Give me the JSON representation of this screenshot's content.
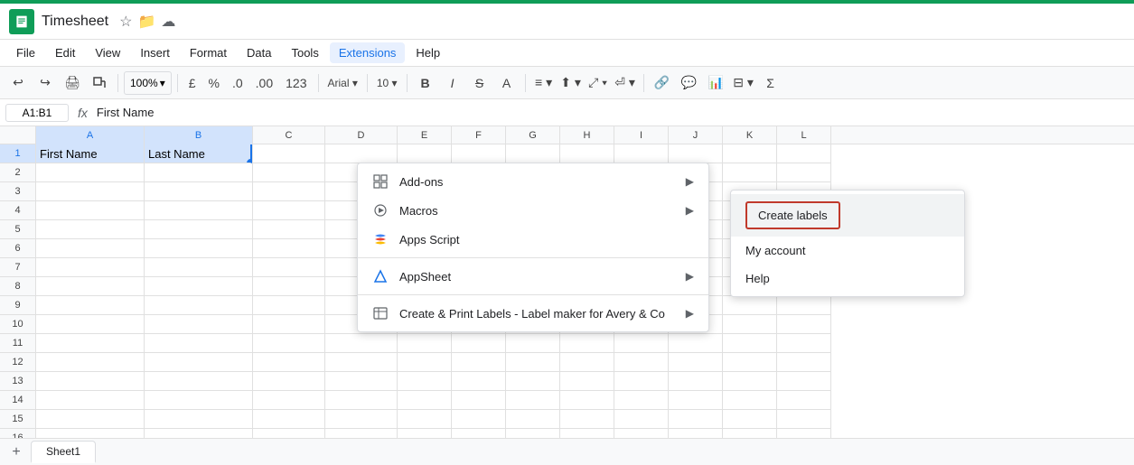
{
  "app": {
    "title": "Timesheet",
    "green_bar_color": "#0f9d58"
  },
  "title_bar": {
    "doc_name": "Timesheet",
    "icons": [
      "star",
      "folder",
      "cloud"
    ]
  },
  "menu": {
    "items": [
      "File",
      "Edit",
      "View",
      "Insert",
      "Format",
      "Data",
      "Tools",
      "Extensions",
      "Help"
    ],
    "active_item": "Extensions"
  },
  "toolbar": {
    "zoom": "100%",
    "currency_symbol": "£",
    "percent_symbol": "%"
  },
  "formula_bar": {
    "cell_ref": "A1:B1",
    "content": "First Name"
  },
  "columns": [
    "A",
    "B",
    "C",
    "D",
    "E",
    "F",
    "G",
    "H",
    "I",
    "J",
    "K",
    "L"
  ],
  "rows": [
    1,
    2,
    3,
    4,
    5,
    6,
    7,
    8,
    9,
    10,
    11,
    12,
    13,
    14,
    15,
    16
  ],
  "cell_data": {
    "A1": "First Name",
    "B1": "Last Name"
  },
  "extensions_menu": {
    "items": [
      {
        "id": "addons",
        "label": "Add-ons",
        "has_arrow": true,
        "icon": "grid"
      },
      {
        "id": "macros",
        "label": "Macros",
        "has_arrow": true,
        "icon": "play"
      },
      {
        "id": "apps_script",
        "label": "Apps Script",
        "has_arrow": false,
        "icon": "apps"
      },
      {
        "id": "appsheet",
        "label": "AppSheet",
        "has_arrow": true,
        "icon": "triangle"
      },
      {
        "id": "labels",
        "label": "Create & Print Labels - Label maker for Avery & Co",
        "has_arrow": true,
        "icon": "table"
      }
    ]
  },
  "labels_submenu": {
    "items": [
      {
        "id": "create_labels",
        "label": "Create labels",
        "highlighted": true,
        "boxed": true
      },
      {
        "id": "my_account",
        "label": "My account",
        "highlighted": false
      },
      {
        "id": "help",
        "label": "Help",
        "highlighted": false
      }
    ]
  },
  "sheet_tabs": [
    {
      "label": "Sheet1",
      "active": true
    }
  ],
  "status_bar": {
    "sheet_name": "Sheet1"
  }
}
